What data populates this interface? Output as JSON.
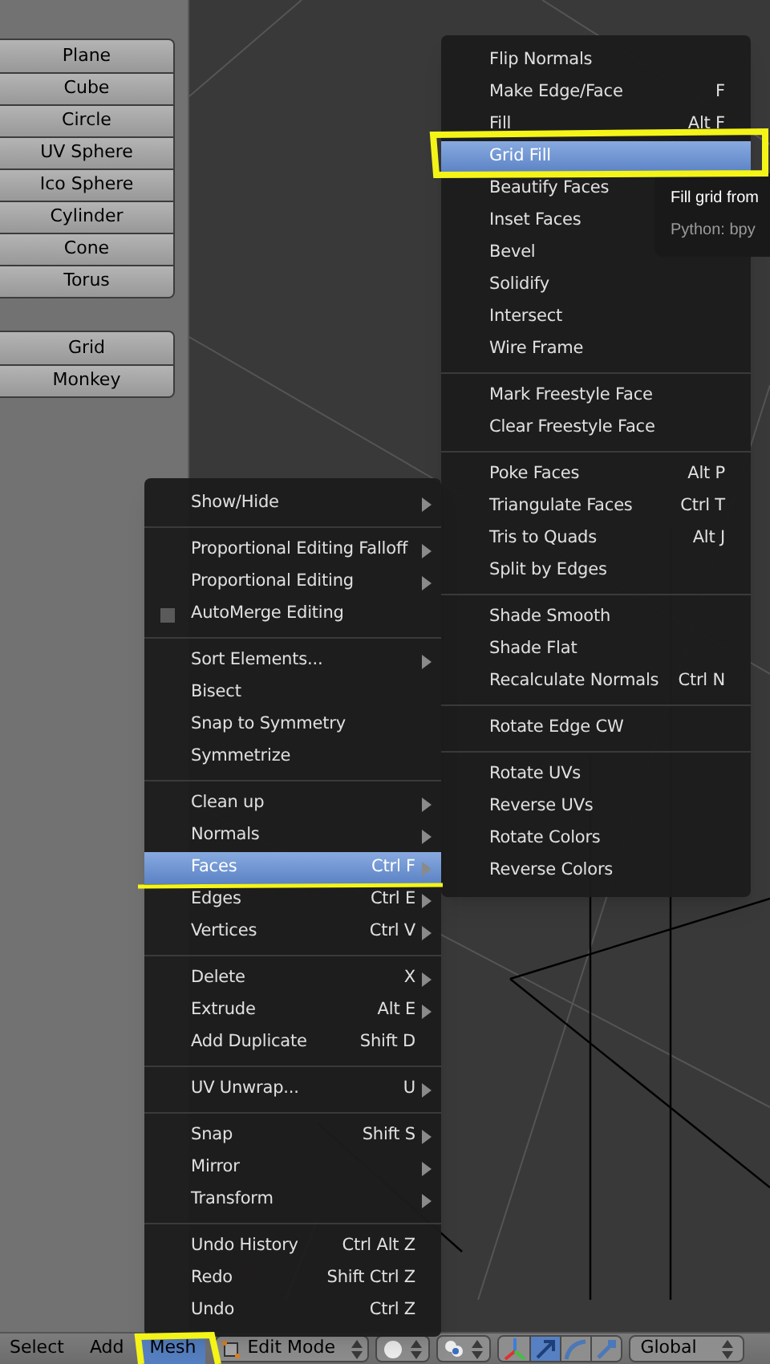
{
  "toolshelf": {
    "groups": [
      {
        "buttons": [
          "Plane",
          "Cube",
          "Circle",
          "UV Sphere",
          "Ico Sphere",
          "Cylinder",
          "Cone",
          "Torus"
        ]
      },
      {
        "buttons": [
          "Grid",
          "Monkey"
        ]
      }
    ]
  },
  "mesh_menu": {
    "groups": [
      {
        "items": [
          {
            "label": "Show/Hide",
            "submenu": true,
            "selected": false
          }
        ]
      },
      {
        "items": [
          {
            "label": "Proportional Editing Falloff",
            "submenu": true,
            "selected": false
          },
          {
            "label": "Proportional Editing",
            "submenu": true,
            "selected": false
          },
          {
            "label": "AutoMerge Editing",
            "kind": "checkbox",
            "checked": false,
            "selected": false
          }
        ]
      },
      {
        "items": [
          {
            "label": "Sort Elements...",
            "submenu": true,
            "selected": false
          },
          {
            "label": "Bisect",
            "selected": false
          },
          {
            "label": "Snap to Symmetry",
            "selected": false
          },
          {
            "label": "Symmetrize",
            "selected": false
          }
        ]
      },
      {
        "items": [
          {
            "label": "Clean up",
            "submenu": true,
            "selected": false
          },
          {
            "label": "Normals",
            "submenu": true,
            "selected": false
          },
          {
            "label": "Faces",
            "shortcut": "Ctrl F",
            "submenu": true,
            "selected": true
          },
          {
            "label": "Edges",
            "shortcut": "Ctrl E",
            "submenu": true,
            "selected": false
          },
          {
            "label": "Vertices",
            "shortcut": "Ctrl V",
            "submenu": true,
            "selected": false
          }
        ]
      },
      {
        "items": [
          {
            "label": "Delete",
            "shortcut": "X",
            "submenu": true,
            "selected": false
          },
          {
            "label": "Extrude",
            "shortcut": "Alt E",
            "submenu": true,
            "selected": false
          },
          {
            "label": "Add Duplicate",
            "shortcut": "Shift D",
            "selected": false
          }
        ]
      },
      {
        "items": [
          {
            "label": "UV Unwrap...",
            "shortcut": "U",
            "submenu": true,
            "selected": false
          }
        ]
      },
      {
        "items": [
          {
            "label": "Snap",
            "shortcut": "Shift S",
            "submenu": true,
            "selected": false
          },
          {
            "label": "Mirror",
            "submenu": true,
            "selected": false
          },
          {
            "label": "Transform",
            "submenu": true,
            "selected": false
          }
        ]
      },
      {
        "items": [
          {
            "label": "Undo History",
            "shortcut": "Ctrl Alt Z",
            "selected": false
          },
          {
            "label": "Redo",
            "shortcut": "Shift Ctrl Z",
            "selected": false
          },
          {
            "label": "Undo",
            "shortcut": "Ctrl Z",
            "selected": false
          }
        ]
      }
    ]
  },
  "faces_submenu": {
    "groups": [
      {
        "items": [
          {
            "label": "Flip Normals",
            "selected": false
          },
          {
            "label": "Make Edge/Face",
            "shortcut": "F",
            "selected": false
          },
          {
            "label": "Fill",
            "shortcut": "Alt F",
            "selected": false
          },
          {
            "label": "Grid Fill",
            "selected": true
          },
          {
            "label": "Beautify Faces",
            "selected": false
          },
          {
            "label": "Inset Faces",
            "selected": false
          },
          {
            "label": "Bevel",
            "selected": false
          },
          {
            "label": "Solidify",
            "selected": false
          },
          {
            "label": "Intersect",
            "selected": false
          },
          {
            "label": "Wire Frame",
            "selected": false
          }
        ]
      },
      {
        "items": [
          {
            "label": "Mark Freestyle Face",
            "selected": false
          },
          {
            "label": "Clear Freestyle Face",
            "selected": false
          }
        ]
      },
      {
        "items": [
          {
            "label": "Poke Faces",
            "shortcut": "Alt P",
            "selected": false
          },
          {
            "label": "Triangulate Faces",
            "shortcut": "Ctrl T",
            "selected": false
          },
          {
            "label": "Tris to Quads",
            "shortcut": "Alt J",
            "selected": false
          },
          {
            "label": "Split by Edges",
            "selected": false
          }
        ]
      },
      {
        "items": [
          {
            "label": "Shade Smooth",
            "selected": false
          },
          {
            "label": "Shade Flat",
            "selected": false
          },
          {
            "label": "Recalculate Normals",
            "shortcut": "Ctrl N",
            "selected": false
          }
        ]
      },
      {
        "items": [
          {
            "label": "Rotate Edge CW",
            "selected": false
          }
        ]
      },
      {
        "items": [
          {
            "label": "Rotate UVs",
            "selected": false
          },
          {
            "label": "Reverse UVs",
            "selected": false
          },
          {
            "label": "Rotate Colors",
            "selected": false
          },
          {
            "label": "Reverse Colors",
            "selected": false
          }
        ]
      }
    ]
  },
  "tooltip": {
    "description": "Fill grid from",
    "python": "Python: bpy"
  },
  "header": {
    "menus": [
      {
        "label": "Select",
        "selected": false
      },
      {
        "label": "Add",
        "selected": false
      },
      {
        "label": "Mesh",
        "selected": true
      }
    ],
    "mode_dropdown": {
      "value": "Edit Mode"
    },
    "manipulators": [
      {
        "kind": "axes",
        "selected": false
      },
      {
        "kind": "translate",
        "selected": true
      },
      {
        "kind": "rotate",
        "selected": false
      },
      {
        "kind": "scale",
        "selected": false
      }
    ],
    "orientation_dropdown": {
      "value": "Global"
    }
  }
}
